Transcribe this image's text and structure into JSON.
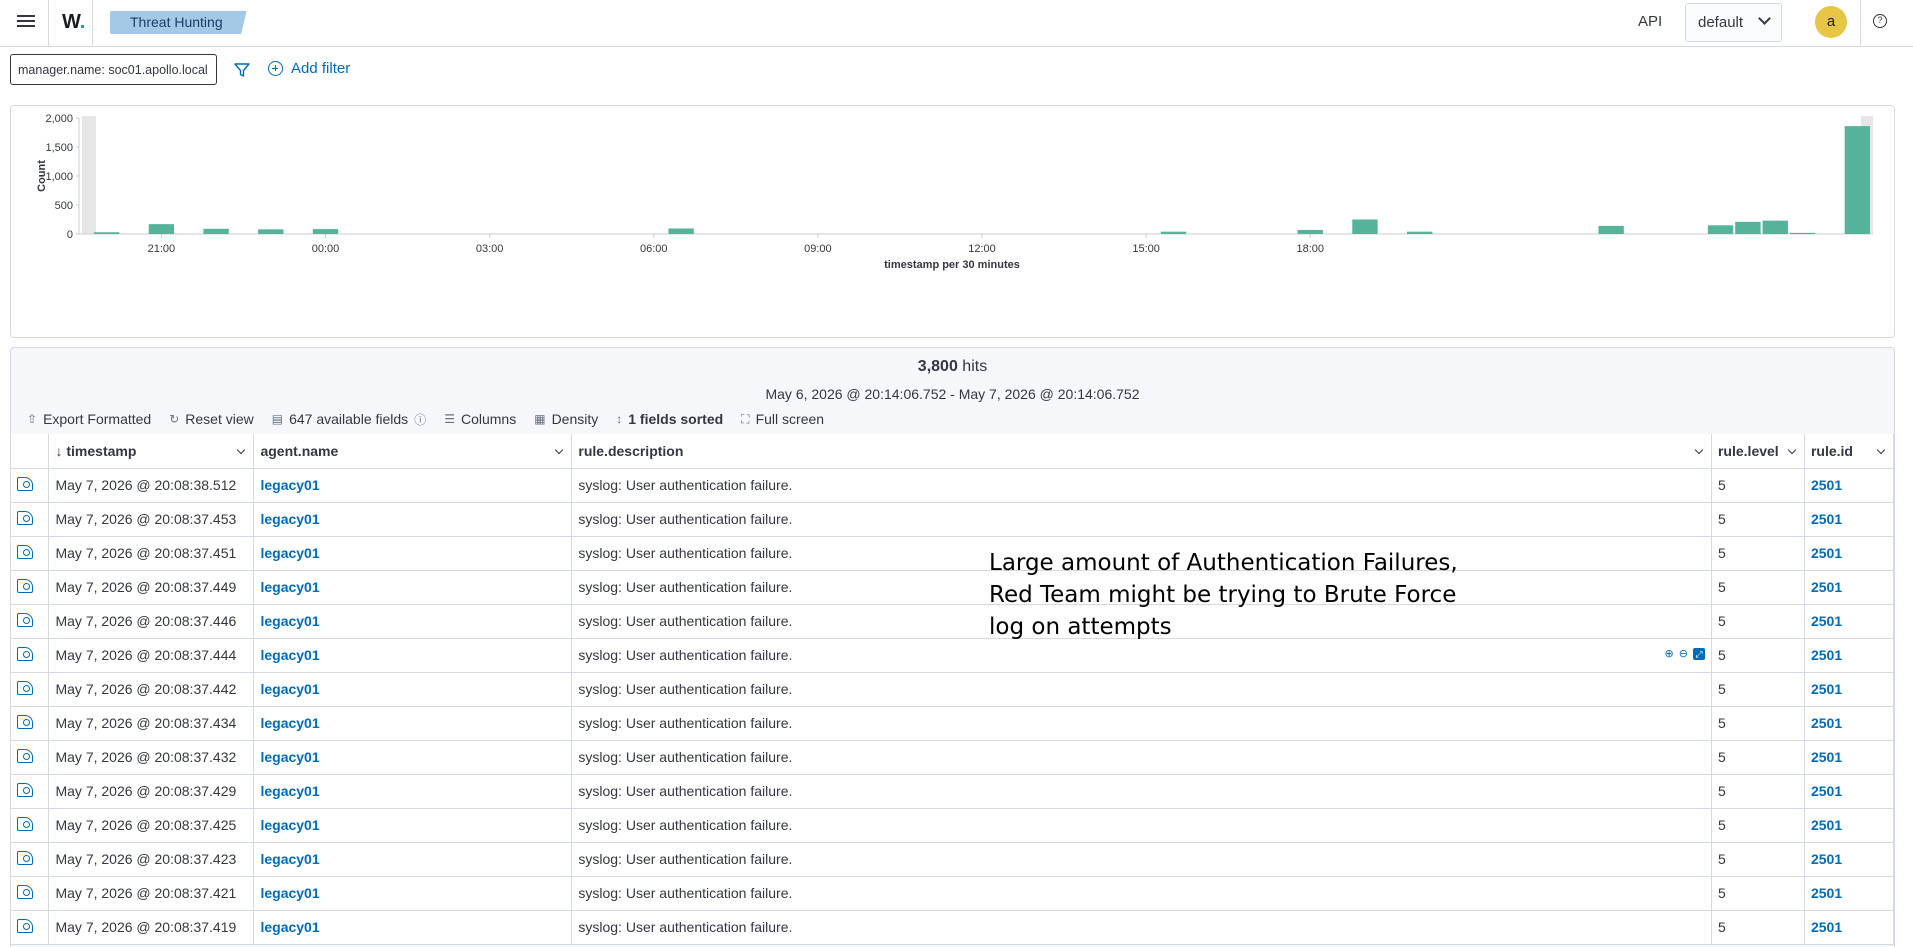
{
  "header": {
    "logo": "W",
    "breadcrumb": "Threat Hunting",
    "api_label": "API",
    "tenant": "default",
    "avatar_initial": "a",
    "help_icon": "question-icon"
  },
  "filters": {
    "pill": "manager.name: soc01.apollo.local",
    "add_filter": "Add filter"
  },
  "chart_data": {
    "type": "bar",
    "xlabel": "timestamp per 30 minutes",
    "ylabel": "Count",
    "yticks": [
      "0",
      "500",
      "1,000",
      "1,500",
      "2,000"
    ],
    "ylim": [
      0,
      2000
    ],
    "xticks": [
      "21:00",
      "00:00",
      "03:00",
      "06:00",
      "09:00",
      "12:00",
      "15:00",
      "18:00"
    ],
    "grid": false,
    "bar_color": "#54b399",
    "bars": [
      {
        "slot": 0,
        "value": 30
      },
      {
        "slot": 2,
        "value": 170
      },
      {
        "slot": 4,
        "value": 90
      },
      {
        "slot": 6,
        "value": 80
      },
      {
        "slot": 8,
        "value": 85
      },
      {
        "slot": 21,
        "value": 95
      },
      {
        "slot": 39,
        "value": 40
      },
      {
        "slot": 44,
        "value": 70
      },
      {
        "slot": 46,
        "value": 250
      },
      {
        "slot": 48,
        "value": 40
      },
      {
        "slot": 55,
        "value": 140
      },
      {
        "slot": 59,
        "value": 150
      },
      {
        "slot": 60,
        "value": 210
      },
      {
        "slot": 61,
        "value": 230
      },
      {
        "slot": 62,
        "value": 20
      },
      {
        "slot": 64,
        "value": 1860
      }
    ]
  },
  "results": {
    "hits_count": "3,800",
    "hits_label": "hits",
    "range": "May 6, 2026 @ 20:14:06.752 - May 7, 2026 @ 20:14:06.752",
    "toolbar": {
      "export": "Export Formatted",
      "reset": "Reset view",
      "fields": "647 available fields",
      "columns": "Columns",
      "density": "Density",
      "sorted": "1 fields sorted",
      "fullscreen": "Full screen"
    },
    "columns": [
      "timestamp",
      "agent.name",
      "rule.description",
      "rule.level",
      "rule.id"
    ],
    "rows": [
      {
        "timestamp": "May 7, 2026 @ 20:08:38.512",
        "agent": "legacy01",
        "desc": "syslog: User authentication failure.",
        "level": "5",
        "id": "2501"
      },
      {
        "timestamp": "May 7, 2026 @ 20:08:37.453",
        "agent": "legacy01",
        "desc": "syslog: User authentication failure.",
        "level": "5",
        "id": "2501"
      },
      {
        "timestamp": "May 7, 2026 @ 20:08:37.451",
        "agent": "legacy01",
        "desc": "syslog: User authentication failure.",
        "level": "5",
        "id": "2501"
      },
      {
        "timestamp": "May 7, 2026 @ 20:08:37.449",
        "agent": "legacy01",
        "desc": "syslog: User authentication failure.",
        "level": "5",
        "id": "2501"
      },
      {
        "timestamp": "May 7, 2026 @ 20:08:37.446",
        "agent": "legacy01",
        "desc": "syslog: User authentication failure.",
        "level": "5",
        "id": "2501"
      },
      {
        "timestamp": "May 7, 2026 @ 20:08:37.444",
        "agent": "legacy01",
        "desc": "syslog: User authentication failure.",
        "level": "5",
        "id": "2501"
      },
      {
        "timestamp": "May 7, 2026 @ 20:08:37.442",
        "agent": "legacy01",
        "desc": "syslog: User authentication failure.",
        "level": "5",
        "id": "2501"
      },
      {
        "timestamp": "May 7, 2026 @ 20:08:37.434",
        "agent": "legacy01",
        "desc": "syslog: User authentication failure.",
        "level": "5",
        "id": "2501"
      },
      {
        "timestamp": "May 7, 2026 @ 20:08:37.432",
        "agent": "legacy01",
        "desc": "syslog: User authentication failure.",
        "level": "5",
        "id": "2501"
      },
      {
        "timestamp": "May 7, 2026 @ 20:08:37.429",
        "agent": "legacy01",
        "desc": "syslog: User authentication failure.",
        "level": "5",
        "id": "2501"
      },
      {
        "timestamp": "May 7, 2026 @ 20:08:37.425",
        "agent": "legacy01",
        "desc": "syslog: User authentication failure.",
        "level": "5",
        "id": "2501"
      },
      {
        "timestamp": "May 7, 2026 @ 20:08:37.423",
        "agent": "legacy01",
        "desc": "syslog: User authentication failure.",
        "level": "5",
        "id": "2501"
      },
      {
        "timestamp": "May 7, 2026 @ 20:08:37.421",
        "agent": "legacy01",
        "desc": "syslog: User authentication failure.",
        "level": "5",
        "id": "2501"
      },
      {
        "timestamp": "May 7, 2026 @ 20:08:37.419",
        "agent": "legacy01",
        "desc": "syslog: User authentication failure.",
        "level": "5",
        "id": "2501"
      }
    ]
  },
  "annotation": "Large amount of Authentication Failures, Red Team might be trying to Brute Force log on attempts"
}
